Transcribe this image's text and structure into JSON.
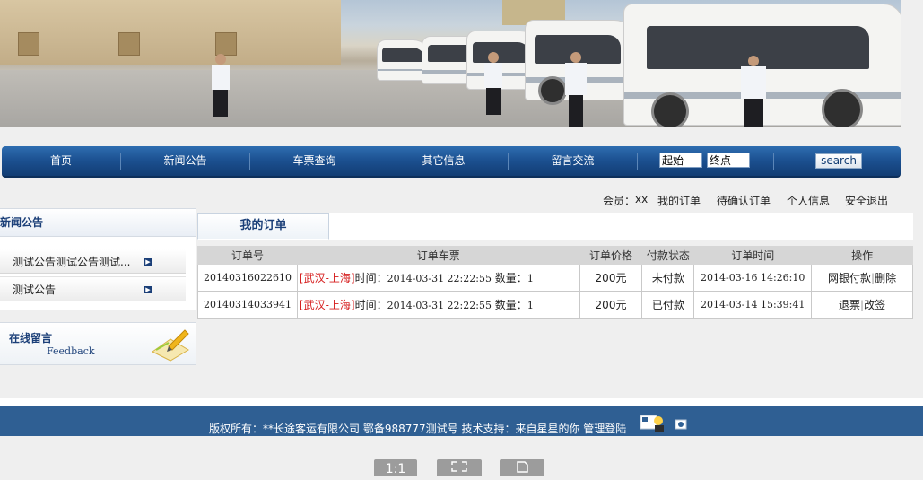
{
  "nav": {
    "items": [
      "首页",
      "新闻公告",
      "车票查询",
      "其它信息",
      "留言交流"
    ],
    "start_value": "起始",
    "end_value": "终点",
    "search_label": "search"
  },
  "userbar": {
    "member_label": "会员：",
    "member_name": "xx",
    "links": [
      "我的订单",
      "待确认订单",
      "个人信息",
      "安全退出"
    ]
  },
  "sidebar": {
    "news_title": "新闻公告",
    "news_items": [
      "测试公告测试公告测试...",
      "测试公告"
    ],
    "feedback_title": "在线留言",
    "feedback_subtitle": "Feedback"
  },
  "orders": {
    "tab_label": "我的订单",
    "headers": [
      "订单号",
      "订单车票",
      "订单价格",
      "付款状态",
      "订单时间",
      "操作"
    ],
    "time_label": "时间：",
    "qty_label": "数量：",
    "rows": [
      {
        "id": "20140316022610",
        "route": "[武汉-上海]",
        "depart_time": "2014-03-31 22:22:55",
        "quantity": "1",
        "price": "200元",
        "status": "未付款",
        "order_time": "2014-03-16 14:26:10",
        "actions": [
          "网银付款",
          "删除"
        ]
      },
      {
        "id": "20140314033941",
        "route": "[武汉-上海]",
        "depart_time": "2014-03-31 22:22:55",
        "quantity": "1",
        "price": "200元",
        "status": "已付款",
        "order_time": "2014-03-14 15:39:41",
        "actions": [
          "退票",
          "改签"
        ]
      }
    ]
  },
  "footer": {
    "text": "版权所有：**长途客运有限公司   鄂备988777测试号  技术支持：来自星星的你   管理登陆"
  },
  "viewer": {
    "zoom_label": "1:1"
  },
  "colors": {
    "nav_blue": "#1b4f8f",
    "footer_blue": "#2f5f93",
    "route_red": "#d61e1e"
  }
}
